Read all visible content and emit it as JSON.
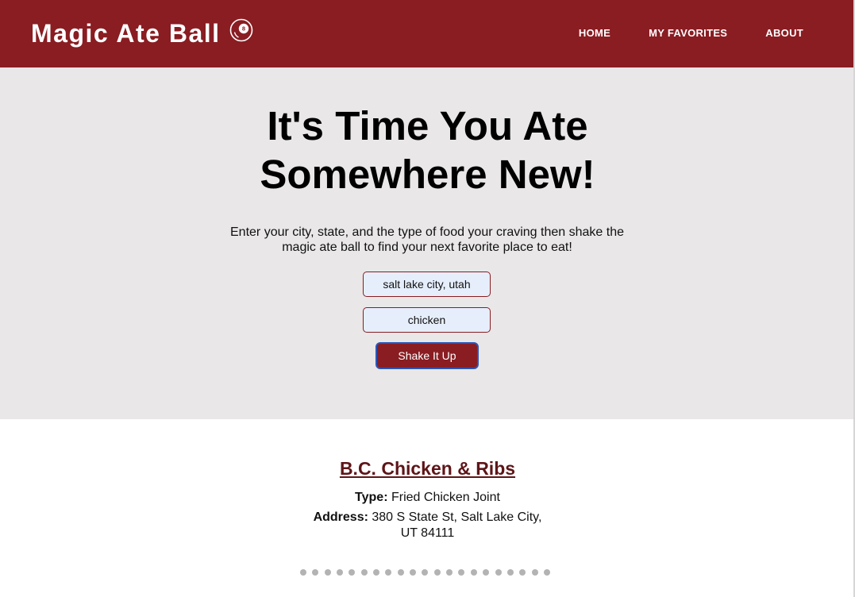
{
  "nav": {
    "brand": "Magic Ate Ball",
    "brand_icon": "eight-ball-icon",
    "links": [
      "HOME",
      "MY FAVORITES",
      "ABOUT"
    ],
    "background": "#891d22"
  },
  "hero": {
    "title_line1": "It's Time You Ate",
    "title_line2": "Somewhere New!",
    "description": "Enter your city, state, and the type of food your craving then shake the magic ate ball to find your next favorite place to eat!",
    "location_value": "salt lake city, utah",
    "food_value": "chicken",
    "button_label": "Shake It Up",
    "background": "#e9e7e8"
  },
  "result": {
    "name": "B.C. Chicken & Ribs",
    "type_label": "Type:",
    "type_value": "Fried Chicken Joint",
    "address_label": "Address:",
    "address_value": "380 S State St, Salt Lake City, UT 84111",
    "carousel_dot_count": 21
  }
}
